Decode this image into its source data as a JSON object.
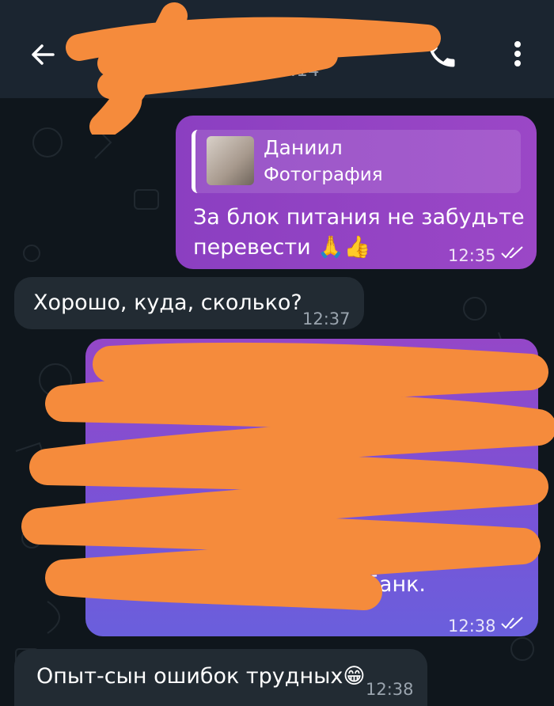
{
  "header": {
    "status": "был(а) в 14:14",
    "back_icon": "arrow-left-icon",
    "call_icon": "phone-icon",
    "menu_icon": "more-vertical-icon"
  },
  "messages": [
    {
      "direction": "outgoing",
      "reply": {
        "name": "Даниил",
        "type": "Фотография"
      },
      "text_line1": "За блок питания не забудьте",
      "text_line2": "перевести 🙏👍",
      "time": "12:35",
      "read": true
    },
    {
      "direction": "incoming",
      "text": "Хорошо, куда, сколько?",
      "time": "12:37"
    },
    {
      "direction": "outgoing",
      "visible_text": "сбербанк.",
      "time": "12:38",
      "read": true
    },
    {
      "direction": "incoming",
      "text": "Опыт-сын ошибок трудных😁",
      "time": "12:38"
    }
  ],
  "colors": {
    "topbar": "#1b2530",
    "background": "#0f161c",
    "incoming_bubble": "#222b33",
    "outgoing_bubble": "#9447c8",
    "redaction": "#f58b3c"
  }
}
